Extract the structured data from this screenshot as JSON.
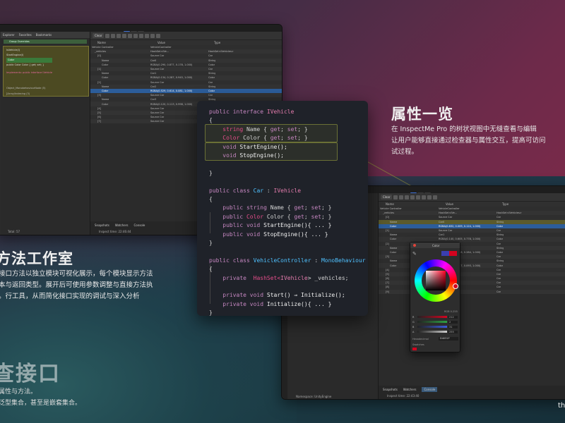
{
  "sections": {
    "properties": {
      "title": "属性一览",
      "desc": [
        "在 InspectMe Pro 的树状视图中无缝查看与编辑",
        "让用户能够直接通过检查器与属性交互，提高可访问",
        "试过程。"
      ]
    },
    "methods": {
      "title": "方法工作室",
      "desc": [
        "接口方法以独立模块可视化展示，每个模块显示方法",
        "本与返回类型。展开后可使用参数调整与直接方法执",
        "。行工具，从而简化接口实现的调试与深入分析"
      ]
    },
    "interfaces": {
      "title": "查接口",
      "desc": [
        "属性与方法。",
        "泛型集合，甚至是嵌套集合。"
      ]
    },
    "corner": "th"
  },
  "left_window": {
    "tabs": [
      "Explorer",
      "Favorites",
      "Bookmarks"
    ],
    "search_box": "Group Overrides",
    "clear_label": "Clear",
    "columns": [
      "Name",
      "Value",
      "Type"
    ],
    "nodes": [
      "IsVehicle(I)",
      "StartEngine(I)",
      "Color",
      "public Color Color { get; set; }",
      "Implements: public interface IVehicle",
      "Object_MonobehaviourNode (5)",
      "[Array/Indexing (3)"
    ],
    "rows": [
      [
        "Vehicle Controller",
        "VehicleController",
        ""
      ],
      [
        "_vehicles",
        "HashSet<IVe...",
        "HashSet<IVehicles>"
      ],
      [
        "[0]",
        "Source Car",
        "Car"
      ],
      [
        "Name",
        "Car0",
        "String"
      ],
      [
        "Color",
        "RGBA(0.290, 0.877, 0.178, 1.000)",
        "Color"
      ],
      [
        "[1]",
        "Source Car",
        "Car"
      ],
      [
        "Name",
        "Car1",
        "String"
      ],
      [
        "Color",
        "RGBA(0.134, 0.287, 0.945, 1.000)",
        "Color"
      ],
      [
        "[2]",
        "Source Car",
        "Car"
      ],
      [
        "Name",
        "Car2",
        "String"
      ],
      [
        "Color",
        "RGBA(0.529, 0.614, 0.081, 1.000)",
        "Color"
      ],
      [
        "[3]",
        "Source Car",
        "Car"
      ],
      [
        "Name",
        "Car3",
        "String"
      ],
      [
        "Color",
        "RGBA(0.120, 0.113, 0.998, 1.000)",
        "Color"
      ],
      [
        "[4]",
        "Source Car",
        "Car"
      ],
      [
        "[5]",
        "Source Car",
        "Car"
      ],
      [
        "[6]",
        "Source Car",
        "Car"
      ],
      [
        "[7]",
        "Source Car",
        "Car"
      ]
    ],
    "bottom_tabs": [
      "Snapshots",
      "Watchers",
      "Console"
    ],
    "total": "Total: 57",
    "inspect_time": "Inspect time: 22:46:44"
  },
  "code": {
    "lines": [
      [
        {
          "t": "public interface ",
          "c": "kw"
        },
        {
          "t": "IVehicle",
          "c": "iface"
        }
      ],
      [
        {
          "t": "{",
          "c": ""
        }
      ],
      [
        {
          "t": "    string ",
          "c": "ty"
        },
        {
          "t": "Name { ",
          "c": ""
        },
        {
          "t": "get",
          "c": "kw"
        },
        {
          "t": "; ",
          "c": ""
        },
        {
          "t": "set",
          "c": "kw"
        },
        {
          "t": "; }",
          "c": ""
        }
      ],
      [
        {
          "t": "    Color ",
          "c": "ty"
        },
        {
          "t": "Color { ",
          "c": ""
        },
        {
          "t": "get",
          "c": "kw"
        },
        {
          "t": "; ",
          "c": ""
        },
        {
          "t": "set",
          "c": "kw"
        },
        {
          "t": "; }",
          "c": ""
        }
      ],
      [
        {
          "t": "    void ",
          "c": "kw"
        },
        {
          "t": "StartEngine();",
          "c": "fn"
        }
      ],
      [
        {
          "t": "    void ",
          "c": "kw"
        },
        {
          "t": "StopEngine();",
          "c": "fn"
        }
      ],
      [
        {
          "t": "",
          "c": ""
        }
      ],
      [
        {
          "t": "}",
          "c": ""
        }
      ],
      [
        {
          "t": "",
          "c": ""
        }
      ],
      [
        {
          "t": "public class ",
          "c": "kw"
        },
        {
          "t": "Car",
          "c": "cls"
        },
        {
          "t": " : ",
          "c": ""
        },
        {
          "t": "IVehicle",
          "c": "iface"
        }
      ],
      [
        {
          "t": "{",
          "c": ""
        }
      ],
      [
        {
          "t": "    public string ",
          "c": "kw"
        },
        {
          "t": "Name { ",
          "c": ""
        },
        {
          "t": "get",
          "c": "kw"
        },
        {
          "t": "; ",
          "c": ""
        },
        {
          "t": "set",
          "c": "kw"
        },
        {
          "t": "; }",
          "c": ""
        }
      ],
      [
        {
          "t": "    public ",
          "c": "kw"
        },
        {
          "t": "Color ",
          "c": "ty"
        },
        {
          "t": "Color { ",
          "c": ""
        },
        {
          "t": "get",
          "c": "kw"
        },
        {
          "t": "; ",
          "c": ""
        },
        {
          "t": "set",
          "c": "kw"
        },
        {
          "t": "; }",
          "c": ""
        }
      ],
      [
        {
          "t": "    public void ",
          "c": "kw"
        },
        {
          "t": "StartEngine(){ ... }",
          "c": "fn"
        }
      ],
      [
        {
          "t": "    public void ",
          "c": "kw"
        },
        {
          "t": "StopEngine(){ ... }",
          "c": "fn"
        }
      ],
      [
        {
          "t": "}",
          "c": ""
        }
      ],
      [
        {
          "t": "",
          "c": ""
        }
      ],
      [
        {
          "t": "public class ",
          "c": "kw"
        },
        {
          "t": "VehicleController",
          "c": "cls"
        },
        {
          "t": " : ",
          "c": ""
        },
        {
          "t": "MonoBehaviour",
          "c": "cls"
        }
      ],
      [
        {
          "t": "{",
          "c": ""
        }
      ],
      [
        {
          "t": "    private  ",
          "c": "kw"
        },
        {
          "t": "HashSet<",
          "c": "ty"
        },
        {
          "t": "IVehicle",
          "c": "iface"
        },
        {
          "t": "> _vehicles;",
          "c": ""
        }
      ],
      [
        {
          "t": "",
          "c": ""
        }
      ],
      [
        {
          "t": "    private void ",
          "c": "kw"
        },
        {
          "t": "Start() ⇒ Initialize();",
          "c": "fn"
        }
      ],
      [
        {
          "t": "    private void ",
          "c": "kw"
        },
        {
          "t": "Initialize(){ ... }",
          "c": "fn"
        }
      ],
      [
        {
          "t": "}",
          "c": ""
        }
      ]
    ]
  },
  "right_window": {
    "clear_label": "Clear",
    "columns": [
      "Name",
      "Value",
      "Type"
    ],
    "rows": [
      [
        "Vehicle Controller",
        "VehicleController",
        ""
      ],
      [
        "_vehicles",
        "HashSet<IVe...",
        "HashSet<IVehicles>"
      ],
      [
        "[0]",
        "Source Car",
        "Car"
      ],
      [
        "Name",
        "Car0",
        "String"
      ],
      [
        "Color",
        "RGBA(0.832, 0.009, 0.124, 1.000)",
        "Color"
      ],
      [
        "[1]",
        "Source Car",
        "Car"
      ],
      [
        "Name",
        "Car1",
        "String"
      ],
      [
        "Color",
        "RGBA(0.140, 0.605, 0.778, 1.000)",
        "Color"
      ],
      [
        "[2]",
        "Source Car",
        "Car"
      ],
      [
        "Name",
        "Car2",
        "String"
      ],
      [
        "Color",
        "RGBA(0.174, 0.758, 0.284, 1.000)",
        "Color"
      ],
      [
        "[3]",
        "Source Car",
        "Car"
      ],
      [
        "Name",
        "Car3",
        "String"
      ],
      [
        "Color",
        "RGBA(0.117, 0.737, 0.093, 1.000)",
        "Color"
      ],
      [
        "[4]",
        "",
        "Car"
      ],
      [
        "[5]",
        "",
        "Car"
      ],
      [
        "[6]",
        "",
        "Car"
      ],
      [
        "[7]",
        "",
        "Car"
      ],
      [
        "[8]",
        "",
        "Car"
      ],
      [
        "[9]",
        "",
        "Car"
      ]
    ],
    "bottom_tabs": [
      "Snapshots",
      "Watchers",
      "Console"
    ],
    "namespace": "Namespace: UnityEngine",
    "inspect_time": "Inspect time: 22:43:40"
  },
  "color_picker": {
    "title": "Color",
    "hex_label": "Hexadecimal",
    "hex_value": "D4031F",
    "channels": [
      {
        "label": "R",
        "value": "212",
        "color": "#d4031f"
      },
      {
        "label": "G",
        "value": "2",
        "color": "#2ea043"
      },
      {
        "label": "B",
        "value": "31",
        "color": "#3b5bdb"
      },
      {
        "label": "A",
        "value": "255",
        "color": "#cccccc"
      }
    ],
    "mode_label": "RGB 0-255",
    "swatches_label": "Swatches",
    "selected_color": "#d4031f"
  }
}
